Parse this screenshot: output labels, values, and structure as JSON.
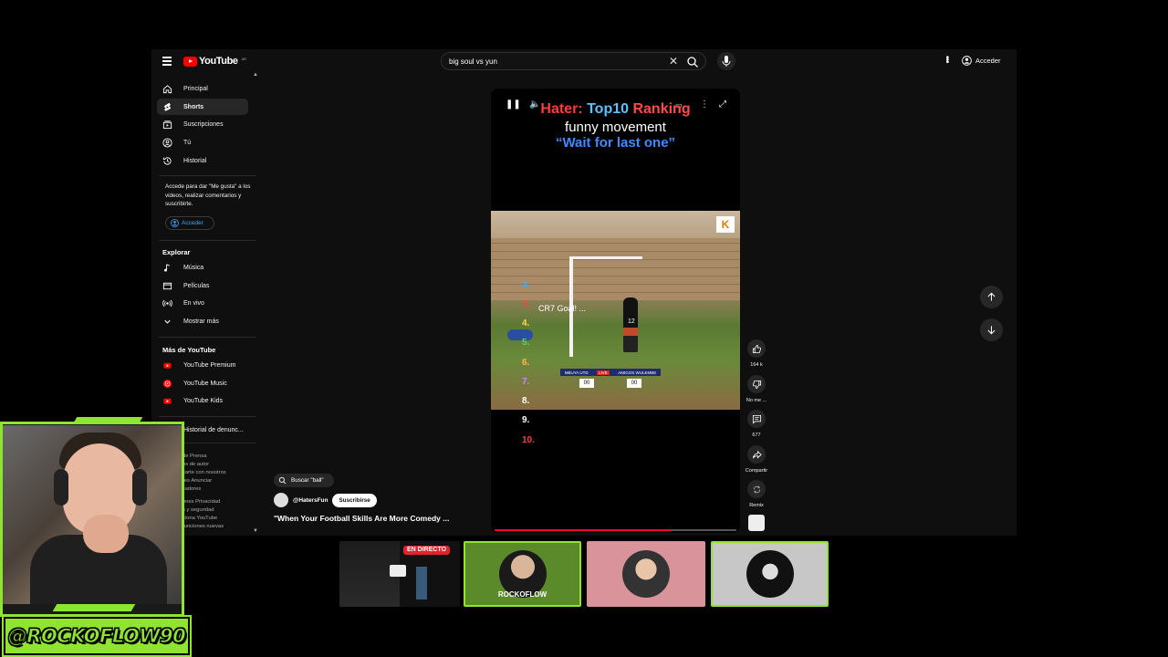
{
  "header": {
    "logo_text": "YouTube",
    "logo_country": "AR",
    "search_value": "big soul vs yun",
    "signin_label": "Acceder"
  },
  "sidebar": {
    "items": [
      {
        "label": "Principal",
        "icon": "home-icon"
      },
      {
        "label": "Shorts",
        "icon": "shorts-icon",
        "active": true
      },
      {
        "label": "Suscripciones",
        "icon": "subscriptions-icon"
      },
      {
        "label": "Tú",
        "icon": "you-icon"
      },
      {
        "label": "Historial",
        "icon": "history-icon"
      }
    ],
    "login_message": "Accede para dar \"Me gusta\" a los videos, realizar comentarios y suscribirte.",
    "login_button": "Acceder",
    "explore_title": "Explorar",
    "explore_items": [
      {
        "label": "Música",
        "icon": "music-icon"
      },
      {
        "label": "Películas",
        "icon": "movies-icon"
      },
      {
        "label": "En vivo",
        "icon": "live-icon"
      },
      {
        "label": "Mostrar más",
        "icon": "chevron-down-icon"
      }
    ],
    "more_title": "Más de YouTube",
    "more_items": [
      {
        "label": "YouTube Premium",
        "icon": "youtube-premium-icon"
      },
      {
        "label": "YouTube Music",
        "icon": "youtube-music-icon"
      },
      {
        "label": "YouTube Kids",
        "icon": "youtube-kids-icon"
      }
    ],
    "report_history": "Historial de denunc...",
    "footer_lines_1": [
      "de  Prensa",
      "os de autor",
      "carte con nosotros",
      "res  Anunciar",
      "lladores"
    ],
    "footer_lines_2": [
      "ones  Privacidad",
      "s y seguridad",
      "ciona YouTube",
      "funciones nuevas"
    ]
  },
  "short": {
    "caption_hater": "Hater:",
    "caption_top10": "Top10",
    "caption_ranking": "Ranking",
    "caption_line2": "funny movement",
    "caption_line3": "“Wait for last one”",
    "ranks": [
      "2.",
      "3.",
      "4.",
      "5.",
      "6.",
      "7.",
      "8.",
      "9.",
      "10."
    ],
    "rank_label": "CR7 Goal! ...",
    "rank_colors": [
      "#4da6ff",
      "#ff4040",
      "#ffd34d",
      "#5fd35f",
      "#ffb84d",
      "#c68bff",
      "#ffffff",
      "#ffffff",
      "#ff4040"
    ],
    "jersey_number": "12",
    "badge": "K",
    "scoreboard_left": "MBUYA UTD",
    "scoreboard_live": "LIVE",
    "scoreboard_right": "AMIGOS WULEMBE",
    "score_left": "00",
    "score_right": "00",
    "progress": 0.73,
    "search_chip": "Buscar \"ball\"",
    "channel": "@HatersFun",
    "subscribe": "Suscribirse",
    "title": "\"When Your Football Skills Are More Comedy ..."
  },
  "actions": {
    "likes": "164 k",
    "dislike": "No me ...",
    "comments": "677",
    "share": "Compartir",
    "remix": "Remix"
  },
  "overlay": {
    "handle": "@ROCKOFLOW90",
    "live_badge": "EN DIRECTO",
    "avatar_text": "ROCKOFLOW"
  },
  "colors": {
    "accent_green": "#8ee42f",
    "youtube_red": "#ff0000",
    "link_blue": "#3ea6ff"
  }
}
